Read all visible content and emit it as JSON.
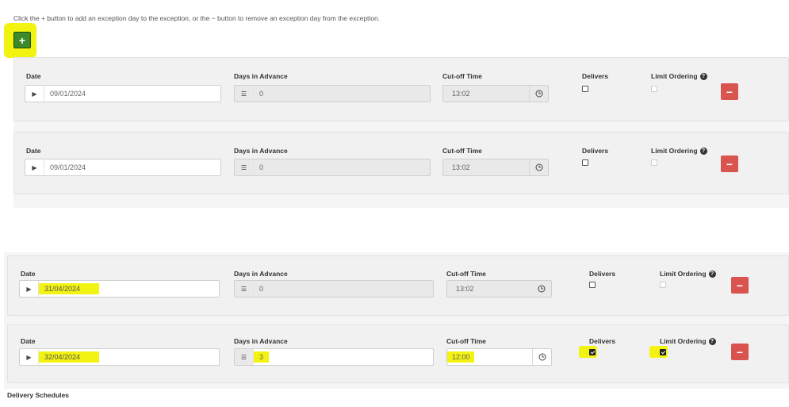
{
  "header": {
    "instruction": "Click the + button to add an exception day to the exception, or the − button to remove an exception day from the exception.",
    "add_glyph": "+"
  },
  "columns": {
    "date": "Date",
    "days_in_advance": "Days in Advance",
    "cutoff_time": "Cut-off Time",
    "delivers": "Delivers",
    "limit_ordering": "Limit Ordering",
    "help_glyph": "?"
  },
  "rows": [
    {
      "date": "09/01/2024",
      "days_in_advance": "0",
      "cutoff_time": "13:02",
      "delivers": false,
      "limit_ordering": false,
      "highlighted": false
    },
    {
      "date": "09/01/2024",
      "days_in_advance": "0",
      "cutoff_time": "13:02",
      "delivers": false,
      "limit_ordering": false,
      "highlighted": false
    },
    {
      "date": "31/04/2024",
      "days_in_advance": "0",
      "cutoff_time": "13:02",
      "delivers": false,
      "limit_ordering": false,
      "highlighted": true
    },
    {
      "date": "32/04/2024",
      "days_in_advance": "3",
      "cutoff_time": "12:00",
      "delivers": true,
      "limit_ordering": true,
      "highlighted": true
    }
  ],
  "remove_glyph": "−",
  "footer": {
    "title": "Delivery Schedules"
  },
  "icons": {
    "add": "plus-icon",
    "remove": "minus-icon",
    "date_toggle": "play-triangle-icon",
    "days": "calendar-list-icon",
    "time": "clock-icon",
    "help": "question-circle-icon"
  },
  "colors": {
    "add_button": "#3c8a2a",
    "remove_button": "#d9534f",
    "highlight": "#f3f312"
  }
}
